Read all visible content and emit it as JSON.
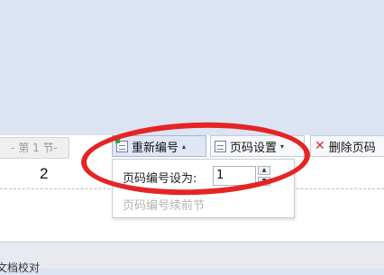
{
  "document": {
    "section_label": "- 第 1 节-",
    "page_number": "2"
  },
  "toolbar": {
    "renumber_label": "重新编号",
    "renumber_caret": "▴",
    "page_number_settings_label": "页码设置",
    "page_number_settings_caret": "▾",
    "delete_label": "删除页码"
  },
  "renumber_dropdown": {
    "set_label": "页码编号设为:",
    "value": "1",
    "continue_label": "页码编号续前节"
  },
  "status_bar": {
    "text": "文档校对"
  },
  "colors": {
    "annotation_ellipse": "#e52424",
    "background": "#dce3f2"
  }
}
